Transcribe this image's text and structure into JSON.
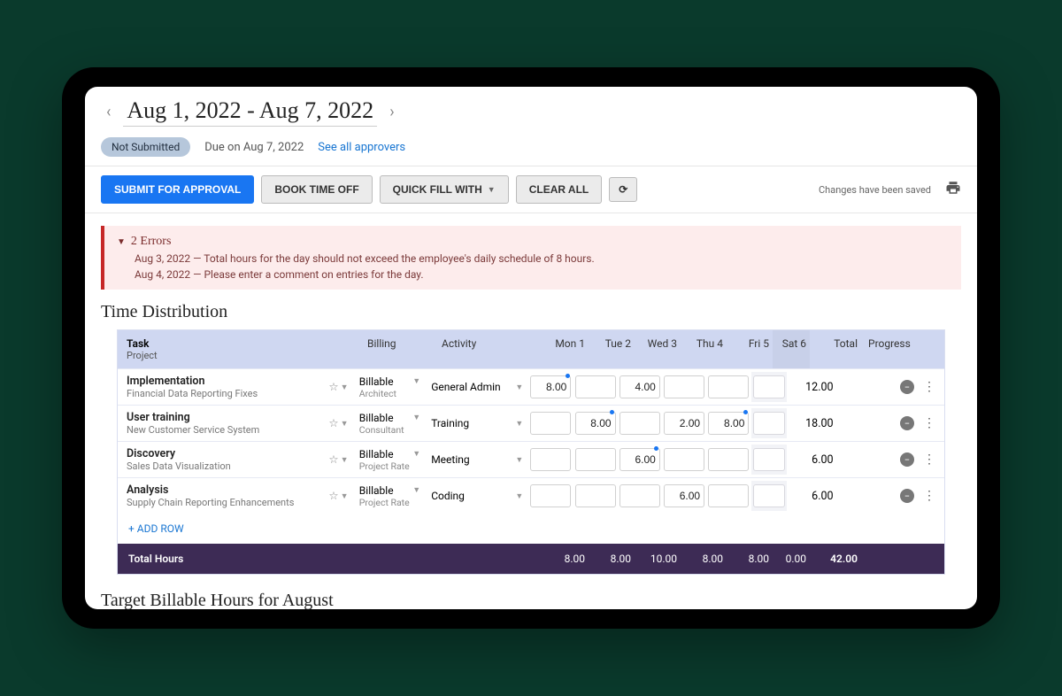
{
  "header": {
    "date_range": "Aug 1, 2022 - Aug 7, 2022",
    "status": "Not Submitted",
    "due": "Due on Aug 7, 2022",
    "approvers_link": "See all approvers"
  },
  "toolbar": {
    "submit": "SUBMIT FOR APPROVAL",
    "book_time_off": "BOOK TIME OFF",
    "quick_fill": "QUICK FILL WITH",
    "clear_all": "CLEAR ALL",
    "saved_msg": "Changes have been saved"
  },
  "errors": {
    "title": "2 Errors",
    "items": [
      "Aug 3, 2022 — Total hours for the day should not exceed the employee's daily schedule of 8 hours.",
      "Aug 4, 2022 — Please enter a comment on entries for the day."
    ]
  },
  "section_title": "Time Distribution",
  "columns": {
    "task": "Task",
    "project": "Project",
    "billing": "Billing",
    "activity": "Activity",
    "days": [
      "Mon 1",
      "Tue 2",
      "Wed 3",
      "Thu 4",
      "Fri 5",
      "Sat 6"
    ],
    "total": "Total",
    "progress": "Progress"
  },
  "rows": [
    {
      "task": "Implementation",
      "project": "Financial Data Reporting Fixes",
      "billing": "Billable",
      "rate": "Architect",
      "activity": "General Admin",
      "hours": [
        "8.00",
        "",
        "4.00",
        "",
        "",
        ""
      ],
      "dots": [
        true,
        false,
        false,
        false,
        false,
        false
      ],
      "total": "12.00"
    },
    {
      "task": "User training",
      "project": "New Customer Service System",
      "billing": "Billable",
      "rate": "Consultant",
      "activity": "Training",
      "hours": [
        "",
        "8.00",
        "",
        "2.00",
        "8.00",
        ""
      ],
      "dots": [
        false,
        true,
        false,
        false,
        true,
        false
      ],
      "total": "18.00"
    },
    {
      "task": "Discovery",
      "project": "Sales Data Visualization",
      "billing": "Billable",
      "rate": "Project Rate",
      "activity": "Meeting",
      "hours": [
        "",
        "",
        "6.00",
        "",
        "",
        ""
      ],
      "dots": [
        false,
        false,
        true,
        false,
        false,
        false
      ],
      "total": "6.00"
    },
    {
      "task": "Analysis",
      "project": "Supply Chain Reporting Enhancements",
      "billing": "Billable",
      "rate": "Project Rate",
      "activity": "Coding",
      "hours": [
        "",
        "",
        "",
        "6.00",
        "",
        ""
      ],
      "dots": [
        false,
        false,
        false,
        false,
        false,
        false
      ],
      "total": "6.00"
    }
  ],
  "add_row": "+ ADD ROW",
  "totals": {
    "label": "Total Hours",
    "days": [
      "8.00",
      "8.00",
      "10.00",
      "8.00",
      "8.00",
      "0.00"
    ],
    "grand": "42.00"
  },
  "section_title2": "Target Billable Hours for August"
}
